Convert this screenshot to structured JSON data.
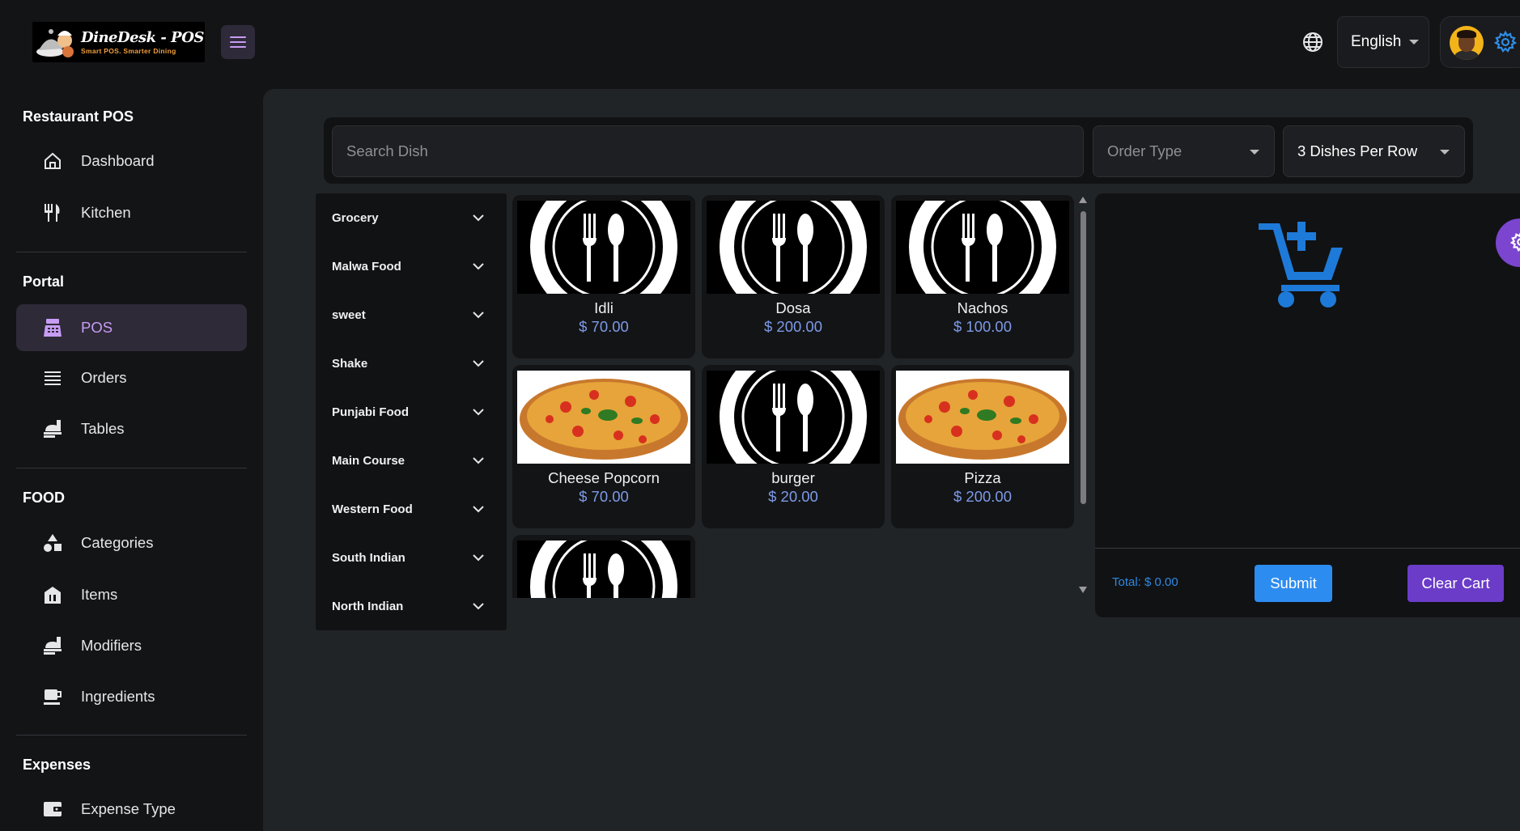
{
  "header": {
    "logo_title": "DineDesk - POS",
    "logo_subtitle": "Smart POS. Smarter Dining",
    "language": "English"
  },
  "sidebar": {
    "sections": [
      {
        "heading": "Restaurant POS",
        "items": [
          {
            "label": "Dashboard",
            "icon": "home-icon"
          },
          {
            "label": "Kitchen",
            "icon": "fork-knife-icon"
          }
        ]
      },
      {
        "heading": "Portal",
        "items": [
          {
            "label": "POS",
            "icon": "cash-register-icon",
            "active": true
          },
          {
            "label": "Orders",
            "icon": "list-icon"
          },
          {
            "label": "Tables",
            "icon": "table-service-icon"
          }
        ]
      },
      {
        "heading": "FOOD",
        "items": [
          {
            "label": "Categories",
            "icon": "shapes-icon"
          },
          {
            "label": "Items",
            "icon": "store-icon"
          },
          {
            "label": "Modifiers",
            "icon": "table-service-icon"
          },
          {
            "label": "Ingredients",
            "icon": "mug-icon"
          }
        ]
      },
      {
        "heading": "Expenses",
        "items": [
          {
            "label": "Expense Type",
            "icon": "wallet-icon"
          }
        ]
      }
    ]
  },
  "toolbar": {
    "search_placeholder": "Search Dish",
    "order_type_placeholder": "Order Type",
    "per_row_value": "3 Dishes Per Row"
  },
  "categories": [
    "Grocery",
    "Malwa Food",
    "sweet",
    "Shake",
    "Punjabi Food",
    "Main Course",
    "Western Food",
    "South Indian",
    "North Indian"
  ],
  "dishes": [
    {
      "name": "Idli",
      "price": "$ 70.00",
      "image": "placeholder-plate"
    },
    {
      "name": "Dosa",
      "price": "$ 200.00",
      "image": "placeholder-plate"
    },
    {
      "name": "Nachos",
      "price": "$ 100.00",
      "image": "placeholder-plate"
    },
    {
      "name": "Cheese Popcorn",
      "price": "$ 70.00",
      "image": "pizza"
    },
    {
      "name": "burger",
      "price": "$ 20.00",
      "image": "placeholder-plate"
    },
    {
      "name": "Pizza",
      "price": "$ 200.00",
      "image": "pizza"
    },
    {
      "name": "",
      "price": "",
      "image": "placeholder-plate"
    }
  ],
  "cart": {
    "total": "Total: $ 0.00",
    "submit_label": "Submit",
    "clear_label": "Clear Cart"
  },
  "colors": {
    "accent_purple": "#6a3cc8",
    "submit_blue": "#2d8cf0",
    "price_blue": "#7d9ae8",
    "active_purple_text": "#c79cf5"
  }
}
